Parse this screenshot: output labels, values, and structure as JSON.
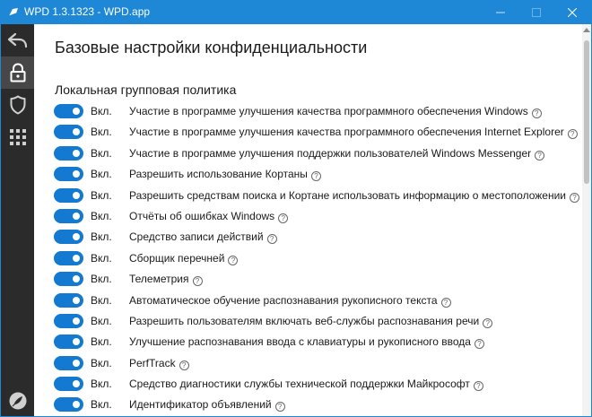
{
  "window": {
    "title": "WPD 1.3.1323 - WPD.app"
  },
  "colors": {
    "titlebar": "#1e87d6",
    "sidebar": "#2b2b2b",
    "toggle_on": "#1479d1"
  },
  "sidebar": {
    "items": [
      {
        "name": "back-arrow-icon"
      },
      {
        "name": "lock-icon"
      },
      {
        "name": "shield-icon"
      },
      {
        "name": "grid-apps-icon"
      },
      {
        "name": "feather-icon"
      }
    ]
  },
  "page": {
    "title": "Базовые настройки конфиденциальности",
    "section_title": "Локальная групповая политика"
  },
  "settings": [
    {
      "state": "Вкл.",
      "label": "Участие в программе улучшения качества программного обеспечения Windows"
    },
    {
      "state": "Вкл.",
      "label": "Участие в программе улучшения качества программного обеспечения Internet Explorer"
    },
    {
      "state": "Вкл.",
      "label": "Участие в программе улучшения поддержки пользователей Windows Messenger"
    },
    {
      "state": "Вкл.",
      "label": "Разрешить использование Кортаны"
    },
    {
      "state": "Вкл.",
      "label": "Разрешить средствам поиска и Кортане использовать информацию о местоположении"
    },
    {
      "state": "Вкл.",
      "label": "Отчёты об ошибках Windows"
    },
    {
      "state": "Вкл.",
      "label": "Средство записи действий"
    },
    {
      "state": "Вкл.",
      "label": "Сборщик перечней"
    },
    {
      "state": "Вкл.",
      "label": "Телеметрия"
    },
    {
      "state": "Вкл.",
      "label": "Автоматическое обучение распознавания рукописного текста"
    },
    {
      "state": "Вкл.",
      "label": "Разрешить пользователям включать веб-службы распознавания речи"
    },
    {
      "state": "Вкл.",
      "label": "Улучшение распознавания ввода с клавиатуры и рукописного ввода"
    },
    {
      "state": "Вкл.",
      "label": "PerfTrack"
    },
    {
      "state": "Вкл.",
      "label": "Средство диагностики службы технической поддержки Майкрософт"
    },
    {
      "state": "Вкл.",
      "label": "Идентификатор объявлений"
    }
  ],
  "help_glyph": "?"
}
